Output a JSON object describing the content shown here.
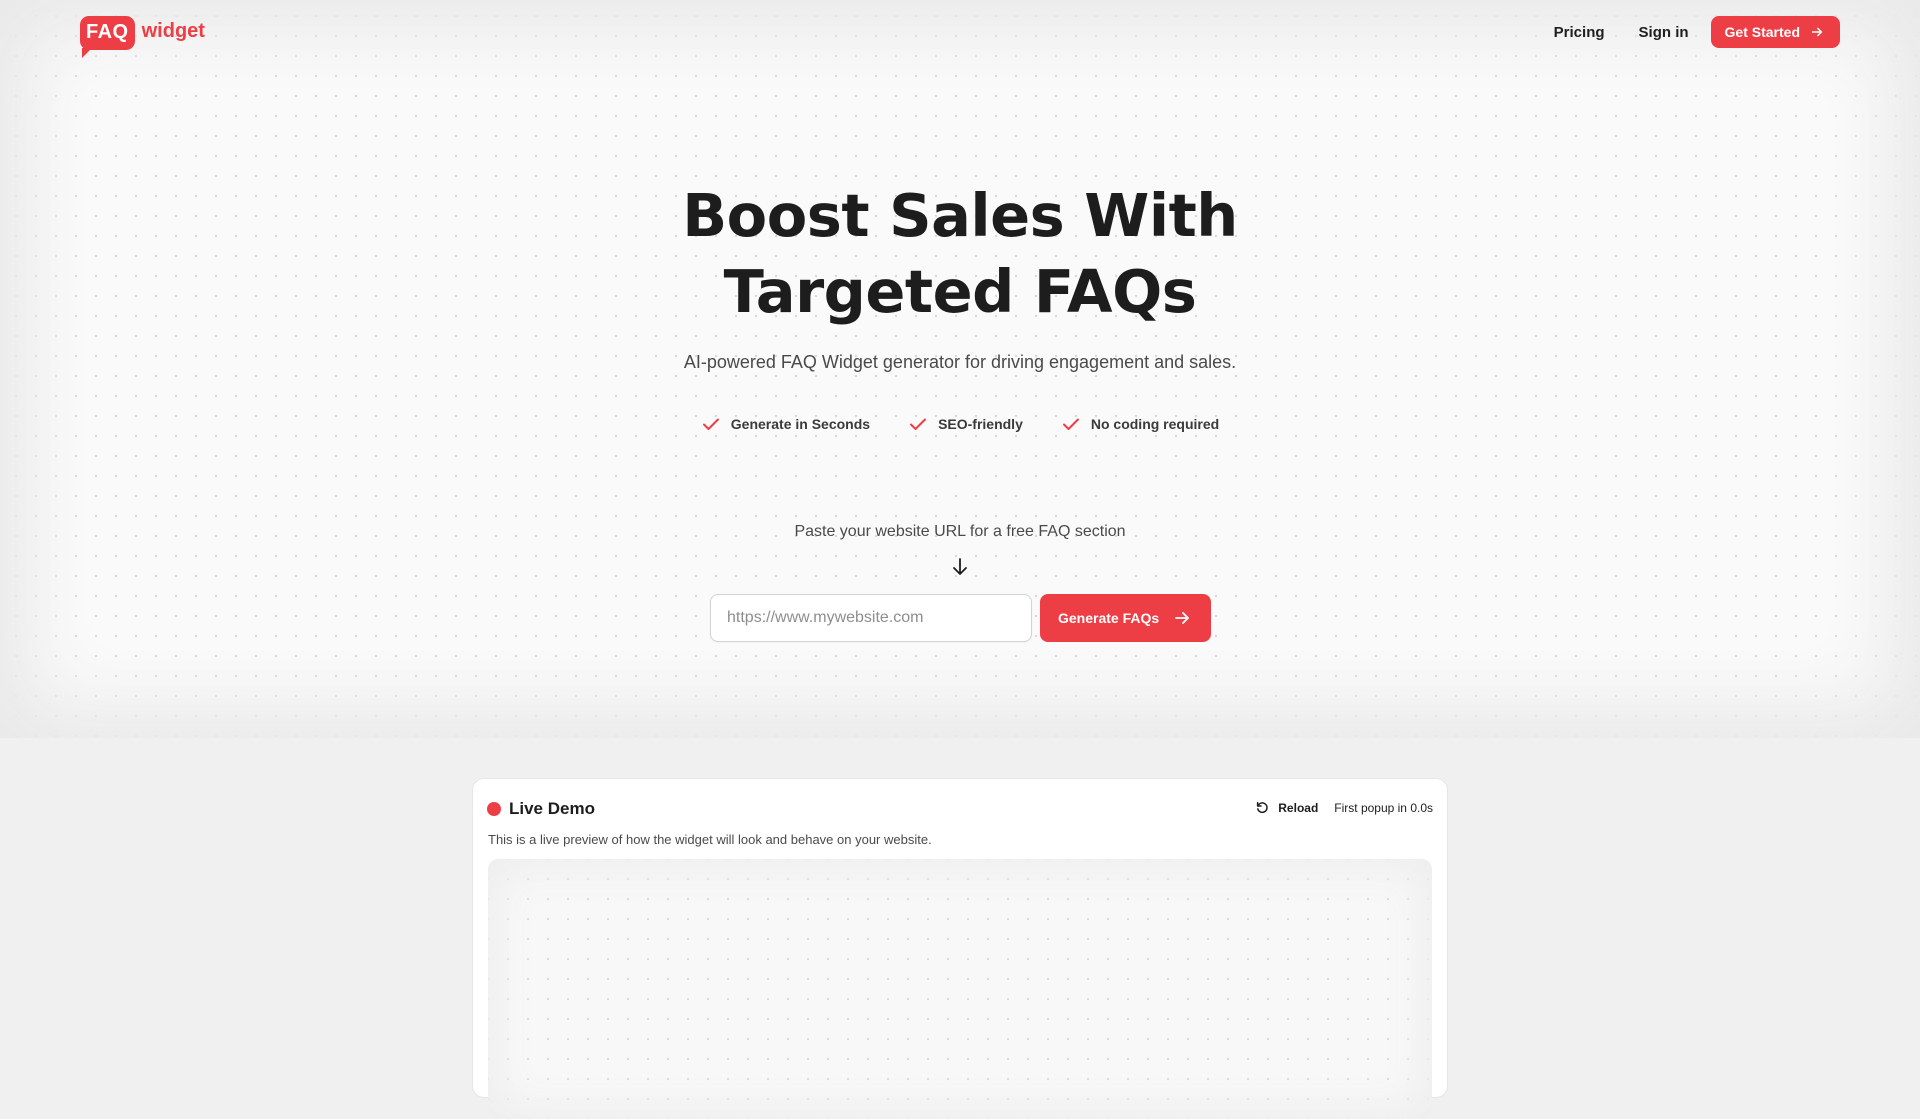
{
  "brand": {
    "logo_mark": "FAQ",
    "logo_word": "widget",
    "accent_color": "#ee3e45"
  },
  "nav": {
    "pricing": "Pricing",
    "sign_in": "Sign in",
    "get_started": "Get Started"
  },
  "hero": {
    "headline_line1": "Boost Sales With",
    "headline_line2": "Targeted FAQs",
    "subheadline": "AI-powered FAQ Widget generator for driving engagement and sales.",
    "features": [
      "Generate in Seconds",
      "SEO-friendly",
      "No coding required"
    ],
    "prompt": "Paste your website URL for a free FAQ section",
    "url_placeholder": "https://www.mywebsite.com",
    "url_value": "",
    "generate_button": "Generate FAQs"
  },
  "demo": {
    "title": "Live Demo",
    "reload": "Reload",
    "popup_timer": "First popup in 0.0s",
    "description": "This is a live preview of how the widget will look and behave on your website."
  },
  "icons": {
    "check": "check-icon",
    "arrow_right": "arrow-right-icon",
    "arrow_down": "arrow-down-icon",
    "reload": "reload-icon"
  }
}
